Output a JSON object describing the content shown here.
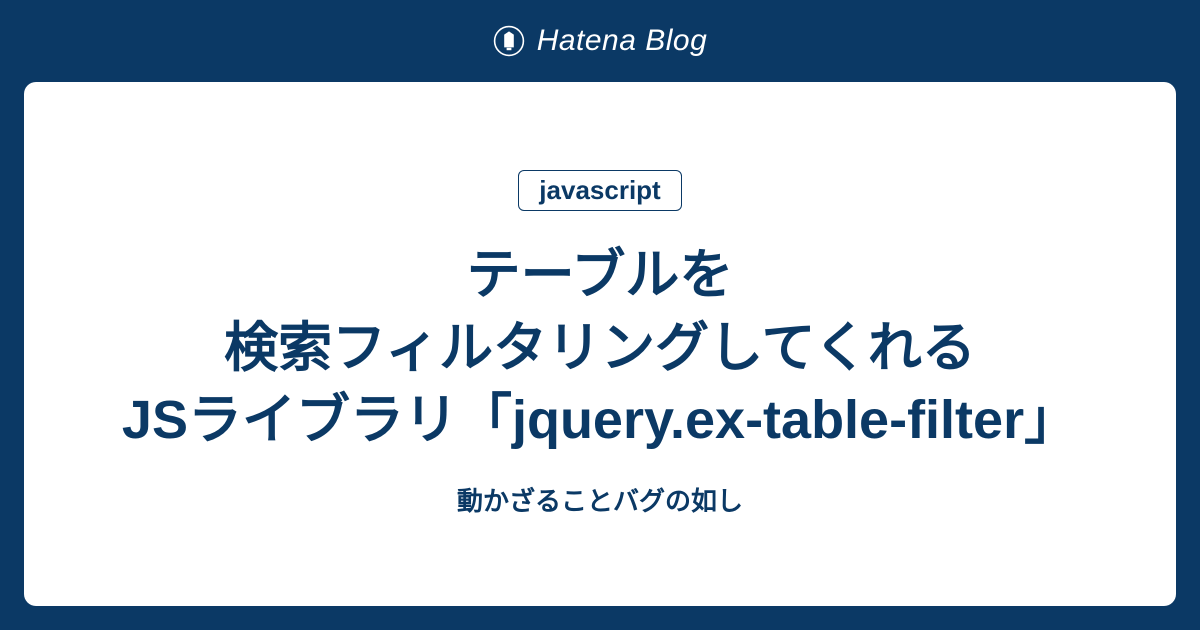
{
  "header": {
    "logo_text": "Hatena Blog"
  },
  "card": {
    "badge": "javascript",
    "title": "テーブルを\n検索フィルタリングしてくれる\nJSライブラリ「jquery.ex-table-filter」",
    "subtitle": "動かざることバグの如し"
  }
}
